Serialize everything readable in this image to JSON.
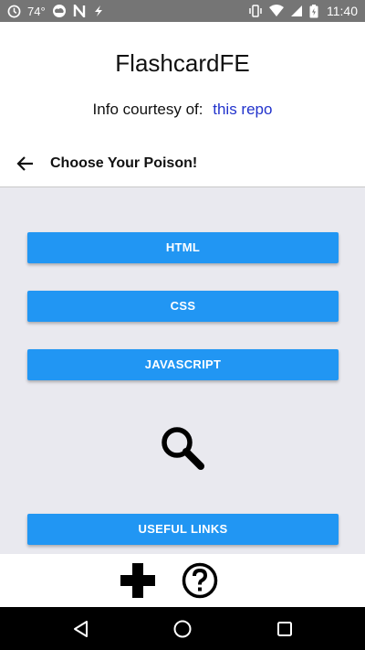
{
  "status_bar": {
    "temperature": "74°",
    "time": "11:40",
    "icons": [
      "clock-icon",
      "cloud-icon",
      "n-icon",
      "lightning-icon",
      "vibrate-icon",
      "wifi-icon",
      "cell-signal-icon",
      "battery-icon"
    ]
  },
  "header": {
    "title": "FlashcardFE",
    "credit_text": "Info courtesy of:",
    "credit_link": "this repo"
  },
  "nav": {
    "back_icon": "arrow-left-icon",
    "title": "Choose Your Poison!"
  },
  "topics": [
    {
      "label": "HTML"
    },
    {
      "label": "CSS"
    },
    {
      "label": "JAVASCRIPT"
    }
  ],
  "search": {
    "icon": "search-icon"
  },
  "useful_links_label": "USEFUL LINKS",
  "toolbar": {
    "add_icon": "plus-icon",
    "help_icon": "help-icon"
  },
  "colors": {
    "accent": "#2196f3",
    "link": "#2233cc",
    "content_bg": "#e9e9ef",
    "status_bar": "#757575"
  }
}
